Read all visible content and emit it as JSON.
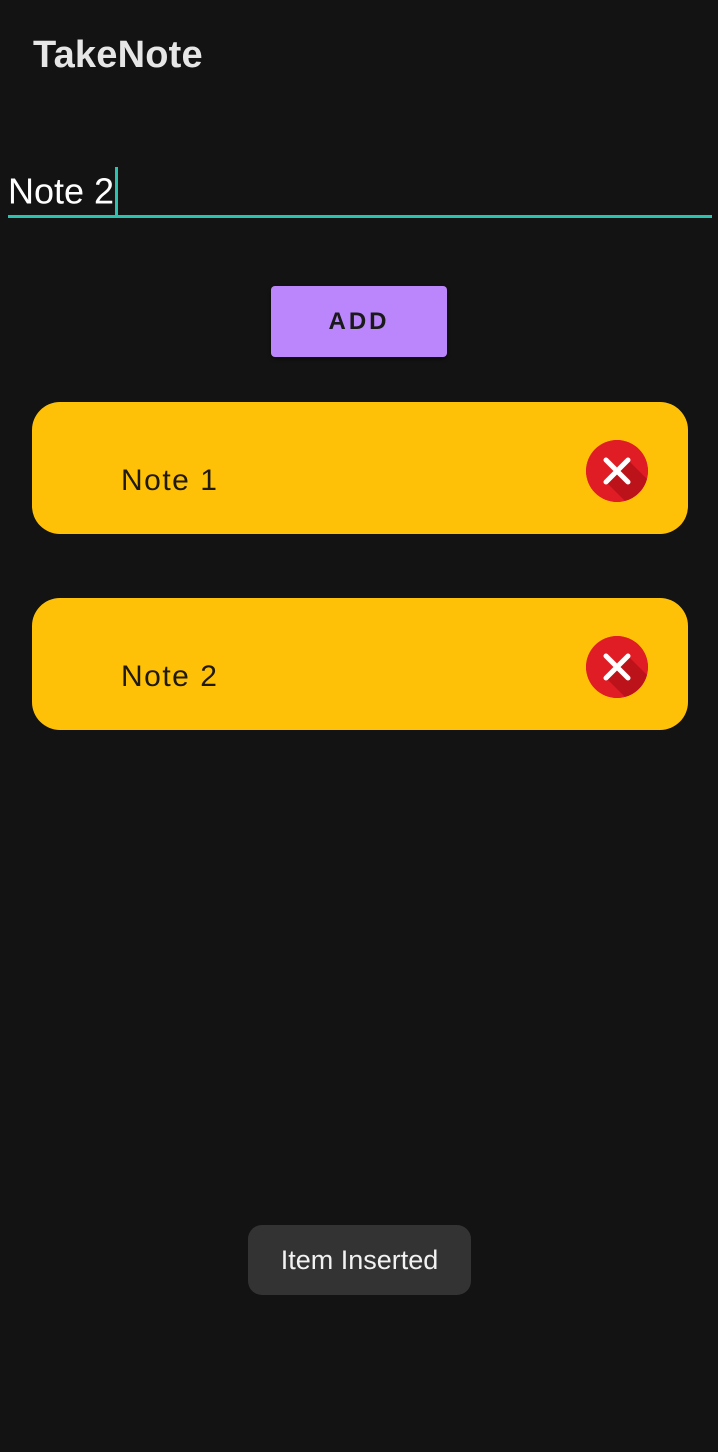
{
  "app": {
    "title": "TakeNote"
  },
  "input": {
    "value": "Note 2",
    "accent_color": "#2bc3b0"
  },
  "add_button": {
    "label": "ADD",
    "color": "#bb86fc"
  },
  "notes": [
    {
      "label": "Note 1",
      "delete_icon": "close-circle-icon"
    },
    {
      "label": "Note 2",
      "delete_icon": "close-circle-icon"
    }
  ],
  "note_card_color": "#ffc107",
  "delete_icon_color": "#e01c25",
  "toast": {
    "message": "Item Inserted"
  }
}
